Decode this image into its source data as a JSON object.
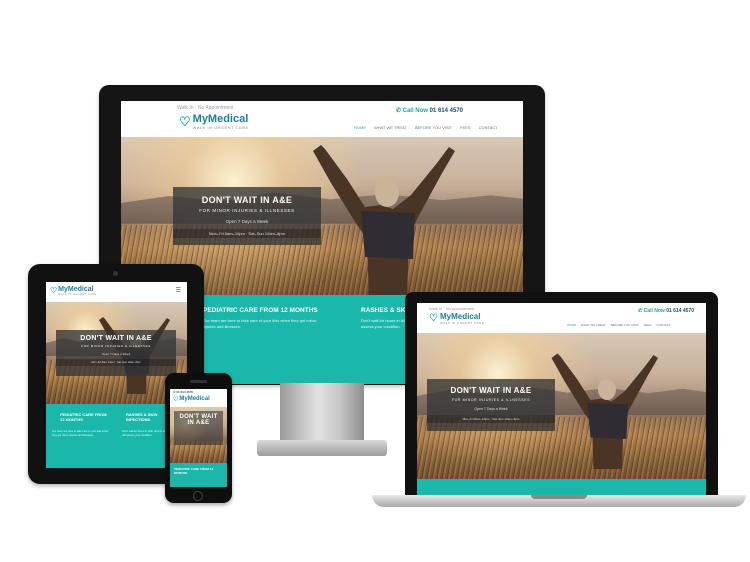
{
  "site": {
    "brand": "MyMedical",
    "tagline": "WALK IN URGENT CARE",
    "call_label": "Call Now",
    "phone": "01 614 4570",
    "top_note": "Walk In · No Appointment",
    "nav": [
      "HOME",
      "WHAT WE TREAT",
      "BEFORE YOU VISIT",
      "FEES",
      "CONTACT"
    ],
    "hero": {
      "title": "DON'T WAIT IN A&E",
      "subtitle": "FOR MINOR INJURIES & ILLNESSES",
      "open_text": "Open 7 Days a Week",
      "hours": "Mon–Fri 8am–10pm · Sat–Sun 10am–8pm"
    },
    "services": [
      {
        "title": "PEDIATRIC CARE FROM 12 MONTHS",
        "text": "Our team are here to take care of your kids when they get minor injuries and illnesses."
      },
      {
        "title": "RASHES & SKIN INFECTIONS",
        "text": "Don't wait for hours in A&E, drop in and our doctors will assess your condition."
      }
    ]
  },
  "devices": {
    "desktop": {
      "label": "desktop-monitor"
    },
    "tablet": {
      "label": "tablet"
    },
    "phone": {
      "label": "phone"
    },
    "laptop": {
      "label": "laptop"
    }
  },
  "colors": {
    "accent": "#1ab8ab",
    "brand_blue": "#1d7e9a",
    "overlay": "#343434",
    "bezel": "#151515"
  }
}
